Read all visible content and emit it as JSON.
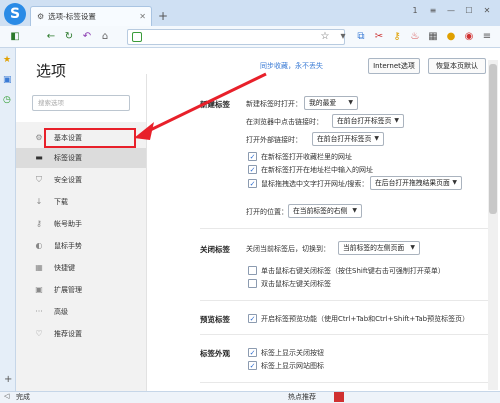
{
  "browser": {
    "tab_title": "选项-标签设置",
    "tab_close": "✕",
    "new_tab": "+",
    "window_buttons": [
      "1",
      "≡",
      "—",
      "☐",
      "✕"
    ],
    "status_text": "完成",
    "status_right": "热点推荐"
  },
  "page": {
    "title": "选项",
    "sync_text": "同步收藏，永不丢失",
    "internet_options": "Internet选项",
    "restore_defaults": "恢复本页默认",
    "search_placeholder": "搜索选项",
    "sidebar": [
      {
        "label": "基本设置",
        "icon": "gear-icon",
        "glyph": "⚙"
      },
      {
        "label": "标签设置",
        "icon": "tab-icon",
        "glyph": "▬"
      },
      {
        "label": "安全设置",
        "icon": "shield-icon",
        "glyph": "⛉"
      },
      {
        "label": "下载",
        "icon": "download-icon",
        "glyph": "↓"
      },
      {
        "label": "帐号助手",
        "icon": "key-icon",
        "glyph": "⚷"
      },
      {
        "label": "鼠标手势",
        "icon": "mouse-icon",
        "glyph": "◐"
      },
      {
        "label": "快捷键",
        "icon": "keyboard-icon",
        "glyph": "▦"
      },
      {
        "label": "扩展管理",
        "icon": "extension-icon",
        "glyph": "▣"
      },
      {
        "label": "高级",
        "icon": "more-icon",
        "glyph": "···"
      },
      {
        "label": "推荐设置",
        "icon": "heart-icon",
        "glyph": "♡"
      }
    ]
  },
  "settings": {
    "new_tab_section": "新建标签",
    "new_tab_open_label": "新建标签时打开：",
    "new_tab_open_value": "我的最爱",
    "middle_click_label": "在浏览器中点击链接时：",
    "middle_click_value": "在前台打开标签页",
    "external_link_label": "打开外部链接时：",
    "external_link_value": "在前台打开标签页",
    "cb1": "在新标签打开收藏栏里的网址",
    "cb2": "在新标签打开在地址栏中输入的网址",
    "cb3": "鼠标拖拽选中文字打开网址/搜索：",
    "cb3_value": "在后台打开拖拽结果页面",
    "open_position_label": "打开的位置：",
    "open_position_value": "在当前标签的右侧",
    "close_section": "关闭标签",
    "close_switch_label": "关闭当前标签后，切换到：",
    "close_switch_value": "当前标签的左侧页面",
    "cb4": "单击鼠标右键关闭标签（按住Shift键右击可强制打开菜单）",
    "cb5": "双击鼠标左键关闭标签",
    "preview_section": "预览标签",
    "cb6": "开启标签预览功能（使用Ctrl+Tab和Ctrl+Shift+Tab预览标签页）",
    "appearance_section": "标签外观",
    "cb7": "标签上显示关闭按钮",
    "cb8": "标签上显示网站图标"
  }
}
